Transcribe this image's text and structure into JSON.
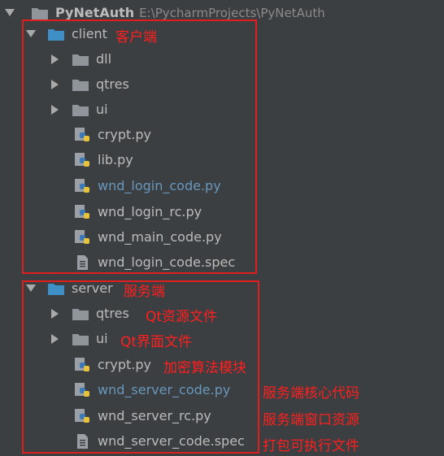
{
  "tree": {
    "root": {
      "name": "PyNetAuth",
      "path": "E:\\PycharmProjects\\PyNetAuth"
    },
    "client": {
      "name": "client",
      "annotation": "客户端",
      "children": [
        {
          "name": "dll",
          "type": "folder"
        },
        {
          "name": "qtres",
          "type": "folder"
        },
        {
          "name": "ui",
          "type": "folder"
        },
        {
          "name": "crypt.py",
          "type": "python"
        },
        {
          "name": "lib.py",
          "type": "python"
        },
        {
          "name": "wnd_login_code.py",
          "type": "python",
          "modified": true
        },
        {
          "name": "wnd_login_rc.py",
          "type": "python"
        },
        {
          "name": "wnd_main_code.py",
          "type": "python"
        },
        {
          "name": "wnd_login_code.spec",
          "type": "text"
        }
      ]
    },
    "server": {
      "name": "server",
      "annotation": "服务端",
      "children": [
        {
          "name": "qtres",
          "type": "folder",
          "annotation": "Qt资源文件"
        },
        {
          "name": "ui",
          "type": "folder",
          "annotation": "Qt界面文件"
        },
        {
          "name": "crypt.py",
          "type": "python",
          "annotation": "加密算法模块"
        },
        {
          "name": "wnd_server_code.py",
          "type": "python",
          "modified": true,
          "annotation": "服务端核心代码"
        },
        {
          "name": "wnd_server_rc.py",
          "type": "python",
          "annotation": "服务端窗口资源"
        },
        {
          "name": "wnd_server_code.spec",
          "type": "text",
          "annotation": "打包可执行文件"
        }
      ]
    }
  },
  "colors": {
    "background": "#3c3f41",
    "text": "#bbbbbb",
    "modified_text": "#6897bb",
    "annotation": "#ff1f1f",
    "folder_icon": "#8f959b",
    "module_folder_icon": "#3d8fc6"
  },
  "icons": {
    "expanded": "triangle-down-icon",
    "collapsed": "triangle-right-icon",
    "folder": "folder-icon",
    "python": "python-file-icon",
    "text": "text-file-icon"
  }
}
